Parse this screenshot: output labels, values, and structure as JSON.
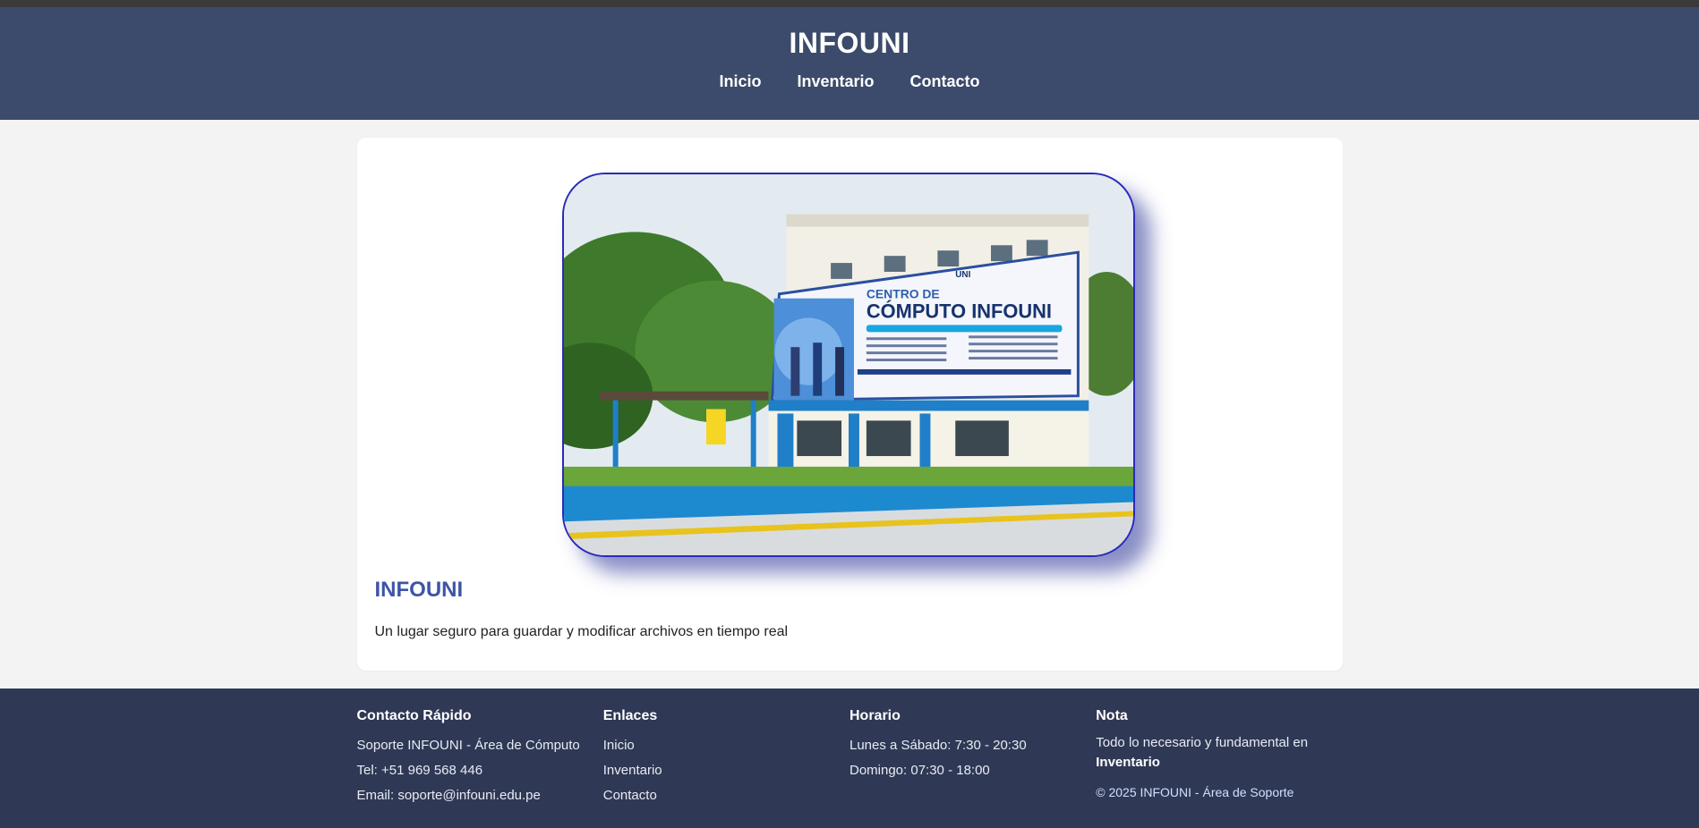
{
  "header": {
    "title": "INFOUNI",
    "nav": [
      "Inicio",
      "Inventario",
      "Contacto"
    ]
  },
  "hero": {
    "image_icon": "building-photo",
    "title": "INFOUNI",
    "description": "Un lugar seguro para guardar y modificar archivos en tiempo real",
    "banner_line1": "CENTRO DE",
    "banner_line2": "CÓMPUTO INFOUNI",
    "banner_logo": "UNI"
  },
  "footer": {
    "contact": {
      "title": "Contacto Rápido",
      "lines": [
        "Soporte INFOUNI - Área de Cómputo",
        "Tel: +51 969 568 446",
        "Email: soporte@infouni.edu.pe"
      ]
    },
    "links": {
      "title": "Enlaces",
      "items": [
        "Inicio",
        "Inventario",
        "Contacto"
      ]
    },
    "schedule": {
      "title": "Horario",
      "lines": [
        "Lunes a Sábado: 7:30 - 20:30",
        "Domingo: 07:30 - 18:00"
      ]
    },
    "note": {
      "title": "Nota",
      "text": "Todo lo necesario y fundamental en",
      "emphasis": "Inventario",
      "copyright": "© 2025 INFOUNI - Área de Soporte"
    }
  },
  "colors": {
    "header_bg": "#3c4a6b",
    "footer_bg": "#2f3854",
    "accent": "#3d55a5",
    "frame_border": "#2a2ab8"
  }
}
